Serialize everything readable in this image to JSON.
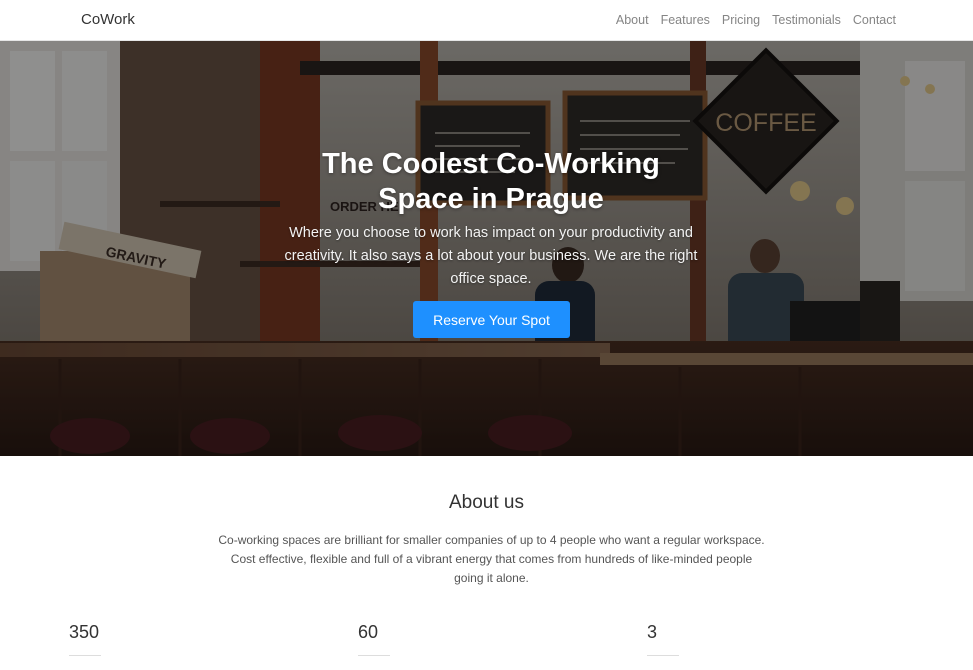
{
  "navbar": {
    "brand": "CoWork",
    "links": [
      "About",
      "Features",
      "Pricing",
      "Testimonials",
      "Contact"
    ]
  },
  "hero": {
    "title_line1": "The Coolest Co-Working",
    "title_line2": "Space in Prague",
    "text": "Where you choose to work has impact on your productivity and creativity. It also says a lot about your business. We are the right office space.",
    "button_label": "Reserve Your Spot",
    "button_color": "#1e90ff",
    "background_description_icon": "cafe-photo",
    "scene_signs": {
      "coffee": "COFFEE",
      "gravity": "GRAVITY",
      "order": "ORDER HE"
    }
  },
  "about": {
    "title": "About us",
    "text_line1": "Co-working spaces are brilliant for smaller companies of up to 4 people who want a regular workspace.",
    "text_line2": "Cost effective, flexible and full of a vibrant energy that comes from hundreds of like-minded people",
    "text_line3": "going it alone."
  },
  "stats": [
    {
      "value": "350"
    },
    {
      "value": "60"
    },
    {
      "value": "3"
    }
  ]
}
